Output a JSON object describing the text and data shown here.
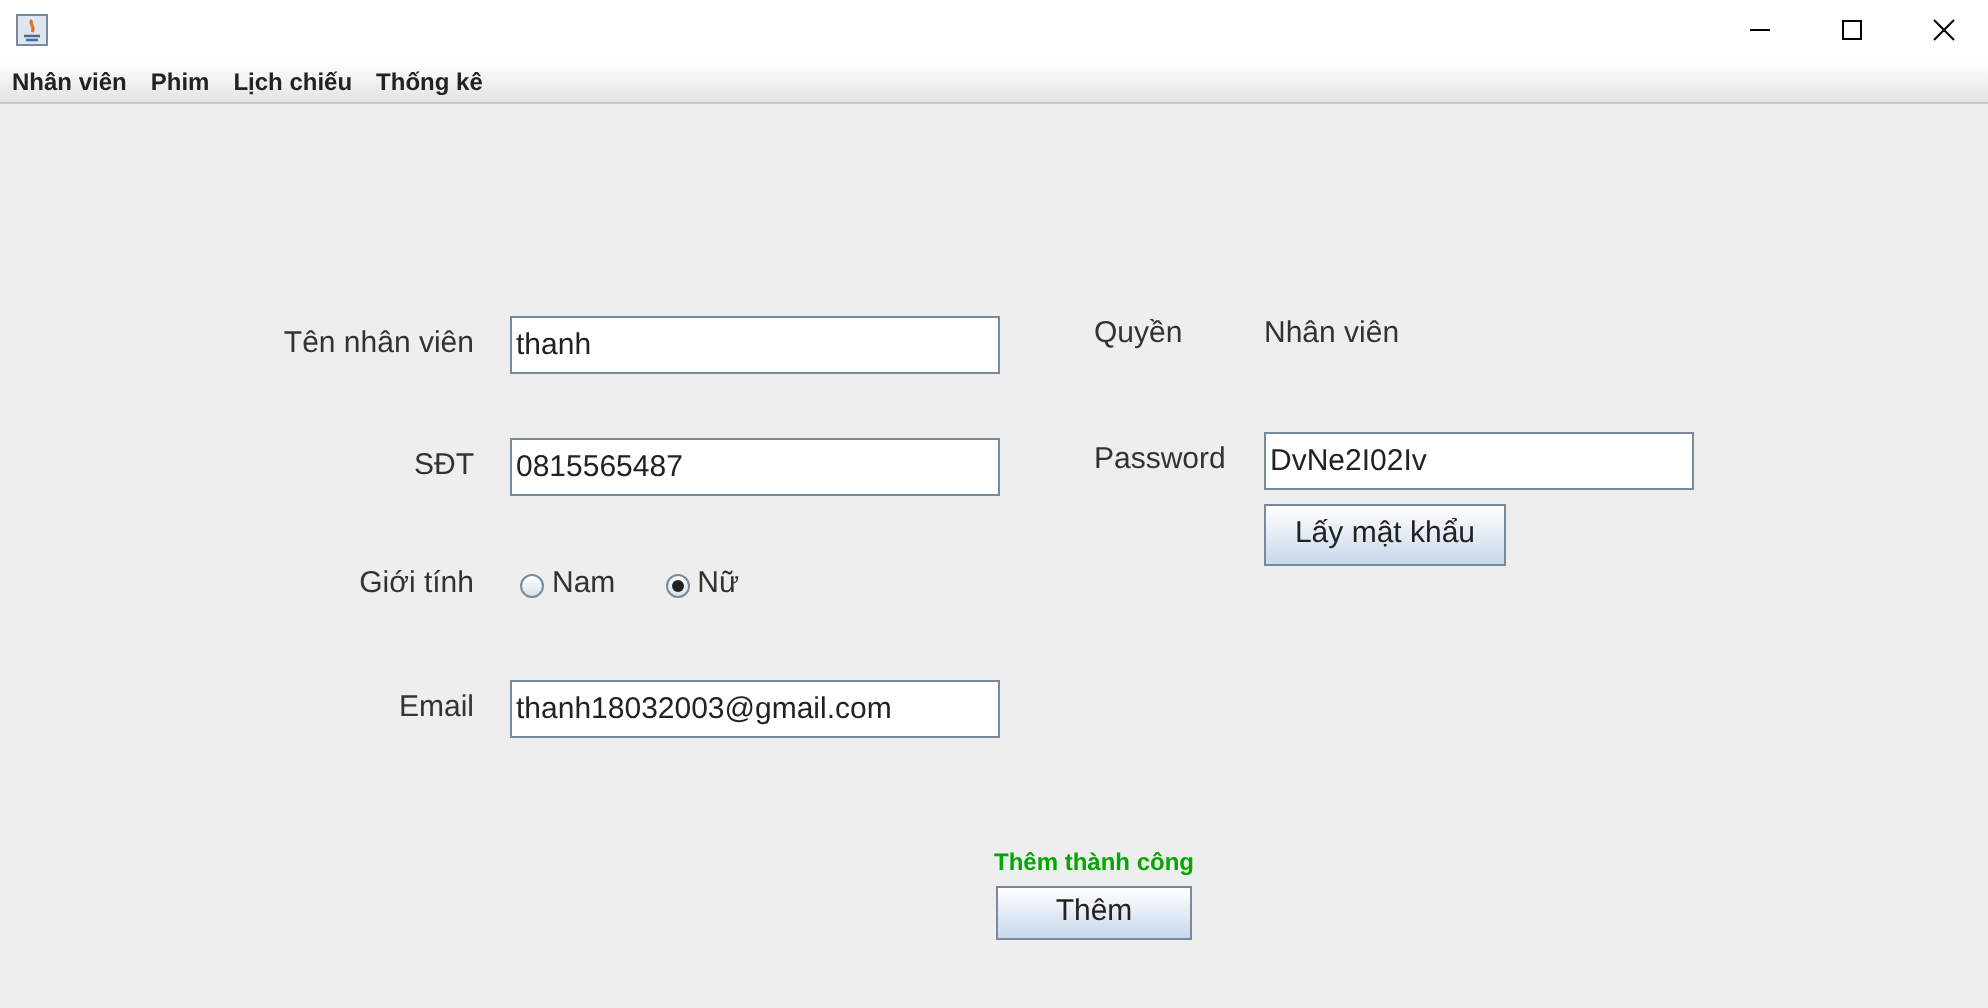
{
  "menu": [
    {
      "label": "Nhân viên"
    },
    {
      "label": "Phim"
    },
    {
      "label": "Lịch chiếu"
    },
    {
      "label": "Thống kê"
    }
  ],
  "fields": [
    {
      "kind": "text",
      "label": "Tên nhân viên",
      "value": "thanh"
    },
    {
      "kind": "text",
      "label": "SĐT",
      "value": "0815565487"
    },
    {
      "kind": "radio",
      "label": "Giới tính",
      "options": [
        {
          "label": "Nam",
          "selected": false
        },
        {
          "label": "Nữ",
          "selected": true
        }
      ]
    },
    {
      "kind": "text",
      "label": "Email",
      "value": "thanh18032003@gmail.com"
    }
  ],
  "role": {
    "label": "Quyền",
    "value": "Nhân viên"
  },
  "password": {
    "label": "Password",
    "value": "DvNe2I02Iv",
    "button": "Lấy mật khẩu"
  },
  "status": "Thêm thành công",
  "submit": "Thêm"
}
